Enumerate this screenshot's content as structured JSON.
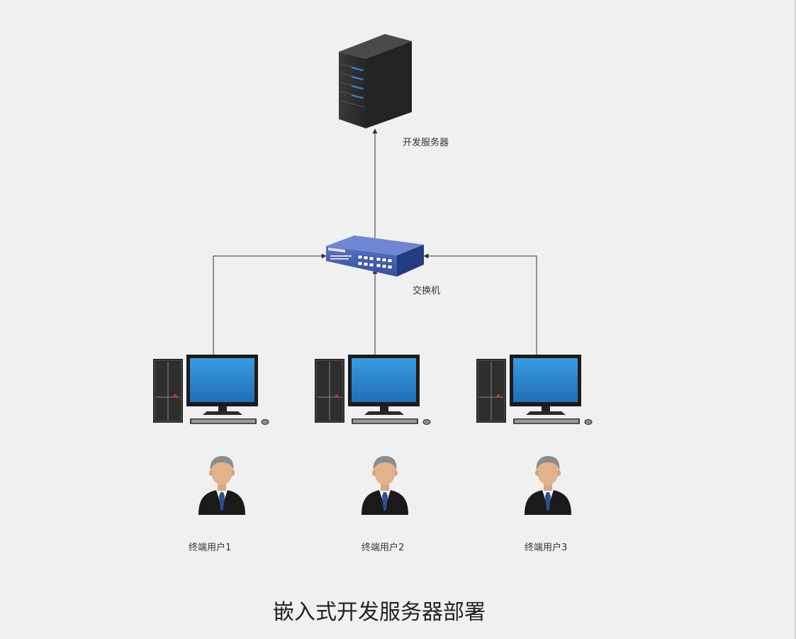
{
  "diagram": {
    "title": "嵌入式开发服务器部署",
    "server": {
      "label": "开发服务器",
      "icon": "server-tower-icon"
    },
    "switch": {
      "label": "交换机",
      "icon": "network-switch-icon"
    },
    "terminals": [
      {
        "label": "终端用户1",
        "pc_icon": "desktop-computer-icon",
        "user_icon": "businessman-icon"
      },
      {
        "label": "终端用户2",
        "pc_icon": "desktop-computer-icon",
        "user_icon": "businessman-icon"
      },
      {
        "label": "终端用户3",
        "pc_icon": "desktop-computer-icon",
        "user_icon": "businessman-icon"
      }
    ],
    "colors": {
      "background": "#f0f0f0",
      "connector": "#333333",
      "server_body": "#2b2b2b",
      "server_led": "#1e90ff",
      "switch_body": "#2e4a9a",
      "monitor_screen": "#2a7fc8",
      "suit": "#1a1a1a",
      "tie": "#2b4f8f"
    }
  }
}
